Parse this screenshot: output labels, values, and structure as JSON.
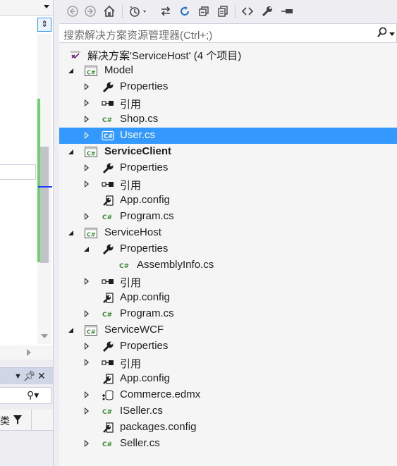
{
  "toolbar": {
    "buttons": [
      "back-icon",
      "forward-icon",
      "home-icon",
      "pending-changes-filter-icon",
      "sync-with-active-document-icon",
      "refresh-icon",
      "collapse-all-icon",
      "show-all-files-icon",
      "view-code-icon",
      "properties-icon",
      "preview-selected-icon"
    ]
  },
  "search": {
    "placeholder": "搜索解决方案资源管理器(Ctrl+;)"
  },
  "solution": {
    "label": "解决方案'ServiceHost' (4 个项目)"
  },
  "tree": [
    {
      "label": "Model",
      "icon": "project",
      "state": "expanded",
      "bold": false,
      "level": 1
    },
    {
      "label": "Properties",
      "icon": "wrench",
      "state": "collapsed",
      "level": 2
    },
    {
      "label": "引用",
      "icon": "references",
      "state": "collapsed",
      "level": 2
    },
    {
      "label": "Shop.cs",
      "icon": "csharp",
      "state": "collapsed",
      "level": 2
    },
    {
      "label": "User.cs",
      "icon": "csharp",
      "state": "collapsed",
      "level": 2,
      "selected": true
    },
    {
      "label": "ServiceClient",
      "icon": "project",
      "state": "expanded",
      "bold": true,
      "level": 1
    },
    {
      "label": "Properties",
      "icon": "wrench",
      "state": "collapsed",
      "level": 2
    },
    {
      "label": "引用",
      "icon": "references",
      "state": "collapsed",
      "level": 2
    },
    {
      "label": "App.config",
      "icon": "config",
      "state": "none",
      "level": 2
    },
    {
      "label": "Program.cs",
      "icon": "csharp",
      "state": "collapsed",
      "level": 2
    },
    {
      "label": "ServiceHost",
      "icon": "project",
      "state": "expanded",
      "bold": false,
      "level": 1
    },
    {
      "label": "Properties",
      "icon": "wrench",
      "state": "expanded",
      "level": 2
    },
    {
      "label": "AssemblyInfo.cs",
      "icon": "csharp",
      "state": "none",
      "level": 3
    },
    {
      "label": "引用",
      "icon": "references",
      "state": "collapsed",
      "level": 2
    },
    {
      "label": "App.config",
      "icon": "config",
      "state": "none",
      "level": 2
    },
    {
      "label": "Program.cs",
      "icon": "csharp",
      "state": "collapsed",
      "level": 2
    },
    {
      "label": "ServiceWCF",
      "icon": "project",
      "state": "expanded",
      "bold": false,
      "level": 1
    },
    {
      "label": "Properties",
      "icon": "wrench",
      "state": "collapsed",
      "level": 2
    },
    {
      "label": "引用",
      "icon": "references",
      "state": "collapsed",
      "level": 2
    },
    {
      "label": "App.config",
      "icon": "config",
      "state": "none",
      "level": 2
    },
    {
      "label": "Commerce.edmx",
      "icon": "edmx",
      "state": "collapsed",
      "level": 2
    },
    {
      "label": "ISeller.cs",
      "icon": "csharp",
      "state": "collapsed",
      "level": 2
    },
    {
      "label": "packages.config",
      "icon": "config",
      "state": "none",
      "level": 2
    },
    {
      "label": "Seller.cs",
      "icon": "csharp",
      "state": "collapsed",
      "level": 2
    }
  ],
  "left_panel": {
    "filter_char": "类"
  },
  "colors": {
    "selection": "#3399ff",
    "csharp_green": "#388a34",
    "vs_purple": "#68217a"
  }
}
